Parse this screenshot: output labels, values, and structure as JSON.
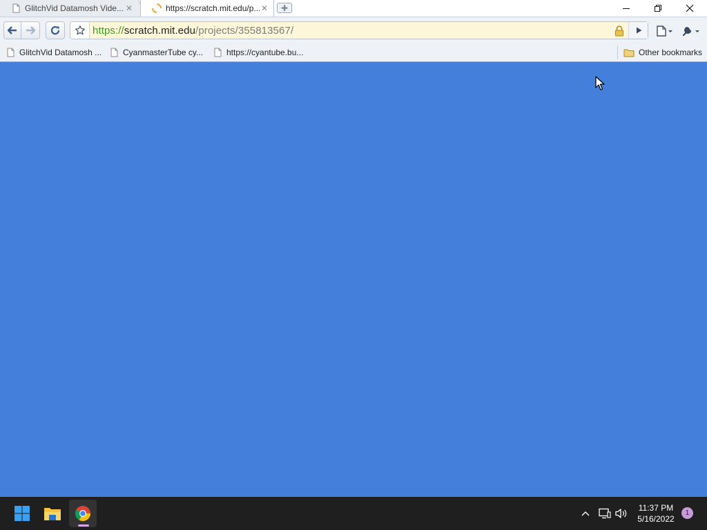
{
  "tabs": [
    {
      "title": "GlitchVid Datamosh Vide...",
      "active": false,
      "icon": "page-icon"
    },
    {
      "title": "https://scratch.mit.edu/p...",
      "active": true,
      "icon": "loading-icon"
    }
  ],
  "toolbar": {
    "url_scheme": "https://",
    "url_host": "scratch.mit.edu",
    "url_path": "/projects/355813567/",
    "omnibox_background": "#fdf6d8"
  },
  "bookmarks": {
    "items": [
      {
        "label": "GlitchVid Datamosh ..."
      },
      {
        "label": "CyanmasterTube cy..."
      },
      {
        "label": "https://cyantube.bu..."
      }
    ],
    "other": "Other bookmarks"
  },
  "page": {
    "background": "#447fdb"
  },
  "taskbar": {
    "time": "11:37 PM",
    "date": "5/16/2022",
    "notification_count": "1",
    "apps": [
      "start",
      "file-explorer",
      "chrome"
    ]
  }
}
